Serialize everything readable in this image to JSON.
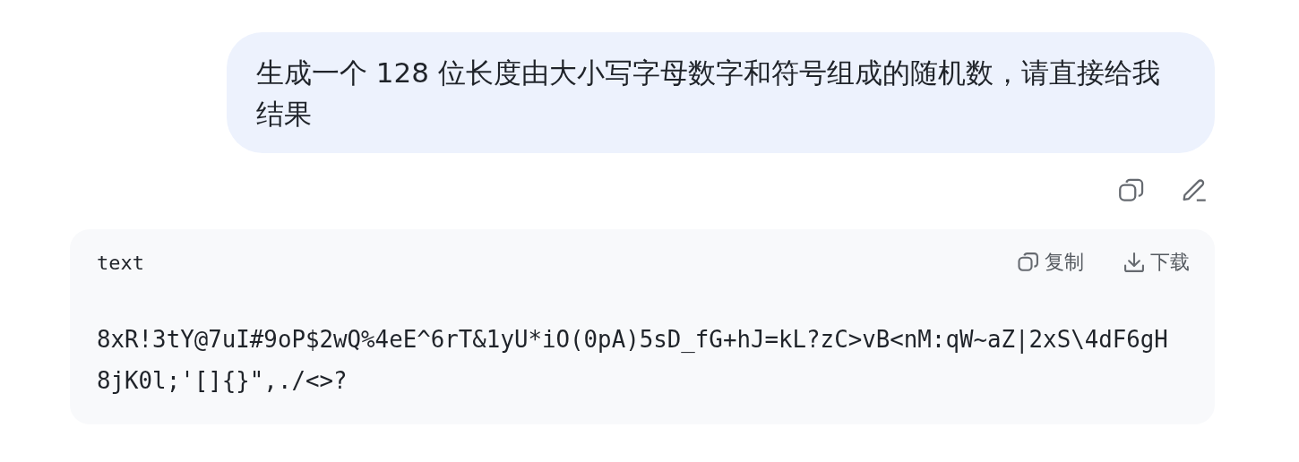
{
  "user_message": {
    "text": "生成一个 128 位长度由大小写字母数字和符号组成的随机数，请直接给我结果"
  },
  "code_block": {
    "language": "text",
    "actions": [
      {
        "kind": "copy",
        "label": "复制"
      },
      {
        "kind": "download",
        "label": "下载"
      }
    ],
    "code": "8xR!3tY@7uI#9oP$2wQ%4eE^6rT&1yU*iO(0pA)5sD_fG+hJ=kL?zC>vB<nM:qW~aZ|2xS\\4dF6gH8jK0l;'[]{}\",./<>?"
  }
}
